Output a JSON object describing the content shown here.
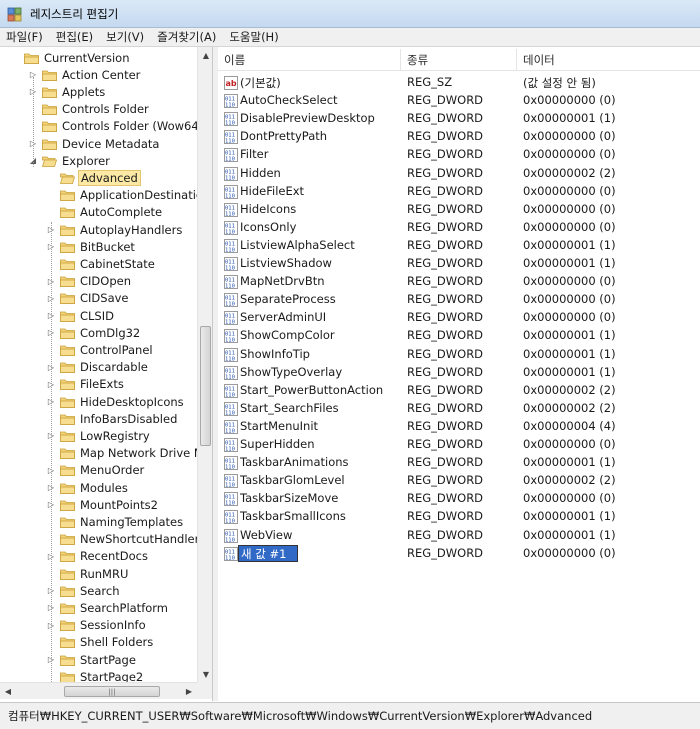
{
  "window": {
    "title": "레지스트리 편집기"
  },
  "menu": [
    "파일(F)",
    "편집(E)",
    "보기(V)",
    "즐겨찾기(A)",
    "도움말(H)"
  ],
  "tree": {
    "rows": [
      {
        "label": "CurrentVersion",
        "level": 0,
        "expander": "",
        "selected": false
      },
      {
        "label": "Action Center",
        "level": 1,
        "expander": "collapsed",
        "selected": false
      },
      {
        "label": "Applets",
        "level": 1,
        "expander": "collapsed",
        "selected": false
      },
      {
        "label": "Controls Folder",
        "level": 1,
        "expander": "",
        "selected": false
      },
      {
        "label": "Controls Folder (Wow64)",
        "level": 1,
        "expander": "",
        "selected": false
      },
      {
        "label": "Device Metadata",
        "level": 1,
        "expander": "collapsed",
        "selected": false
      },
      {
        "label": "Explorer",
        "level": 1,
        "expander": "expanded",
        "selected": false
      },
      {
        "label": "Advanced",
        "level": 2,
        "expander": "",
        "selected": true
      },
      {
        "label": "ApplicationDestinations",
        "level": 2,
        "expander": "",
        "selected": false
      },
      {
        "label": "AutoComplete",
        "level": 2,
        "expander": "",
        "selected": false
      },
      {
        "label": "AutoplayHandlers",
        "level": 2,
        "expander": "collapsed",
        "selected": false
      },
      {
        "label": "BitBucket",
        "level": 2,
        "expander": "collapsed",
        "selected": false
      },
      {
        "label": "CabinetState",
        "level": 2,
        "expander": "",
        "selected": false
      },
      {
        "label": "CIDOpen",
        "level": 2,
        "expander": "collapsed",
        "selected": false
      },
      {
        "label": "CIDSave",
        "level": 2,
        "expander": "collapsed",
        "selected": false
      },
      {
        "label": "CLSID",
        "level": 2,
        "expander": "collapsed",
        "selected": false
      },
      {
        "label": "ComDlg32",
        "level": 2,
        "expander": "collapsed",
        "selected": false
      },
      {
        "label": "ControlPanel",
        "level": 2,
        "expander": "",
        "selected": false
      },
      {
        "label": "Discardable",
        "level": 2,
        "expander": "collapsed",
        "selected": false
      },
      {
        "label": "FileExts",
        "level": 2,
        "expander": "collapsed",
        "selected": false
      },
      {
        "label": "HideDesktopIcons",
        "level": 2,
        "expander": "collapsed",
        "selected": false
      },
      {
        "label": "InfoBarsDisabled",
        "level": 2,
        "expander": "",
        "selected": false
      },
      {
        "label": "LowRegistry",
        "level": 2,
        "expander": "collapsed",
        "selected": false
      },
      {
        "label": "Map Network Drive MRU",
        "level": 2,
        "expander": "",
        "selected": false
      },
      {
        "label": "MenuOrder",
        "level": 2,
        "expander": "collapsed",
        "selected": false
      },
      {
        "label": "Modules",
        "level": 2,
        "expander": "collapsed",
        "selected": false
      },
      {
        "label": "MountPoints2",
        "level": 2,
        "expander": "collapsed",
        "selected": false
      },
      {
        "label": "NamingTemplates",
        "level": 2,
        "expander": "",
        "selected": false
      },
      {
        "label": "NewShortcutHandlers",
        "level": 2,
        "expander": "",
        "selected": false
      },
      {
        "label": "RecentDocs",
        "level": 2,
        "expander": "collapsed",
        "selected": false
      },
      {
        "label": "RunMRU",
        "level": 2,
        "expander": "",
        "selected": false
      },
      {
        "label": "Search",
        "level": 2,
        "expander": "collapsed",
        "selected": false
      },
      {
        "label": "SearchPlatform",
        "level": 2,
        "expander": "collapsed",
        "selected": false
      },
      {
        "label": "SessionInfo",
        "level": 2,
        "expander": "collapsed",
        "selected": false
      },
      {
        "label": "Shell Folders",
        "level": 2,
        "expander": "",
        "selected": false
      },
      {
        "label": "StartPage",
        "level": 2,
        "expander": "collapsed",
        "selected": false
      },
      {
        "label": "StartPage2",
        "level": 2,
        "expander": "",
        "selected": false
      }
    ]
  },
  "list": {
    "headers": {
      "name": "이름",
      "type": "종류",
      "data": "데이터"
    },
    "rows": [
      {
        "icon": "string-value-icon",
        "name": "(기본값)",
        "type": "REG_SZ",
        "data": "(값 설정 안 됨)"
      },
      {
        "icon": "dword-value-icon",
        "name": "AutoCheckSelect",
        "type": "REG_DWORD",
        "data": "0x00000000 (0)"
      },
      {
        "icon": "dword-value-icon",
        "name": "DisablePreviewDesktop",
        "type": "REG_DWORD",
        "data": "0x00000001 (1)"
      },
      {
        "icon": "dword-value-icon",
        "name": "DontPrettyPath",
        "type": "REG_DWORD",
        "data": "0x00000000 (0)"
      },
      {
        "icon": "dword-value-icon",
        "name": "Filter",
        "type": "REG_DWORD",
        "data": "0x00000000 (0)"
      },
      {
        "icon": "dword-value-icon",
        "name": "Hidden",
        "type": "REG_DWORD",
        "data": "0x00000002 (2)"
      },
      {
        "icon": "dword-value-icon",
        "name": "HideFileExt",
        "type": "REG_DWORD",
        "data": "0x00000000 (0)"
      },
      {
        "icon": "dword-value-icon",
        "name": "HideIcons",
        "type": "REG_DWORD",
        "data": "0x00000000 (0)"
      },
      {
        "icon": "dword-value-icon",
        "name": "IconsOnly",
        "type": "REG_DWORD",
        "data": "0x00000000 (0)"
      },
      {
        "icon": "dword-value-icon",
        "name": "ListviewAlphaSelect",
        "type": "REG_DWORD",
        "data": "0x00000001 (1)"
      },
      {
        "icon": "dword-value-icon",
        "name": "ListviewShadow",
        "type": "REG_DWORD",
        "data": "0x00000001 (1)"
      },
      {
        "icon": "dword-value-icon",
        "name": "MapNetDrvBtn",
        "type": "REG_DWORD",
        "data": "0x00000000 (0)"
      },
      {
        "icon": "dword-value-icon",
        "name": "SeparateProcess",
        "type": "REG_DWORD",
        "data": "0x00000000 (0)"
      },
      {
        "icon": "dword-value-icon",
        "name": "ServerAdminUI",
        "type": "REG_DWORD",
        "data": "0x00000000 (0)"
      },
      {
        "icon": "dword-value-icon",
        "name": "ShowCompColor",
        "type": "REG_DWORD",
        "data": "0x00000001 (1)"
      },
      {
        "icon": "dword-value-icon",
        "name": "ShowInfoTip",
        "type": "REG_DWORD",
        "data": "0x00000001 (1)"
      },
      {
        "icon": "dword-value-icon",
        "name": "ShowTypeOverlay",
        "type": "REG_DWORD",
        "data": "0x00000001 (1)"
      },
      {
        "icon": "dword-value-icon",
        "name": "Start_PowerButtonAction",
        "type": "REG_DWORD",
        "data": "0x00000002 (2)"
      },
      {
        "icon": "dword-value-icon",
        "name": "Start_SearchFiles",
        "type": "REG_DWORD",
        "data": "0x00000002 (2)"
      },
      {
        "icon": "dword-value-icon",
        "name": "StartMenuInit",
        "type": "REG_DWORD",
        "data": "0x00000004 (4)"
      },
      {
        "icon": "dword-value-icon",
        "name": "SuperHidden",
        "type": "REG_DWORD",
        "data": "0x00000000 (0)"
      },
      {
        "icon": "dword-value-icon",
        "name": "TaskbarAnimations",
        "type": "REG_DWORD",
        "data": "0x00000001 (1)"
      },
      {
        "icon": "dword-value-icon",
        "name": "TaskbarGlomLevel",
        "type": "REG_DWORD",
        "data": "0x00000002 (2)"
      },
      {
        "icon": "dword-value-icon",
        "name": "TaskbarSizeMove",
        "type": "REG_DWORD",
        "data": "0x00000000 (0)"
      },
      {
        "icon": "dword-value-icon",
        "name": "TaskbarSmallIcons",
        "type": "REG_DWORD",
        "data": "0x00000001 (1)"
      },
      {
        "icon": "dword-value-icon",
        "name": "WebView",
        "type": "REG_DWORD",
        "data": "0x00000001 (1)"
      },
      {
        "icon": "dword-value-icon",
        "name": "새 값 #1",
        "type": "REG_DWORD",
        "data": "0x00000000 (0)",
        "editing": true
      }
    ]
  },
  "status": {
    "path": "컴퓨터₩HKEY_CURRENT_USER₩Software₩Microsoft₩Windows₩CurrentVersion₩Explorer₩Advanced"
  },
  "colors": {
    "selection_highlight": "#fbe9a5",
    "edit_highlight": "#3169c6",
    "folder": "#e8c35a"
  }
}
